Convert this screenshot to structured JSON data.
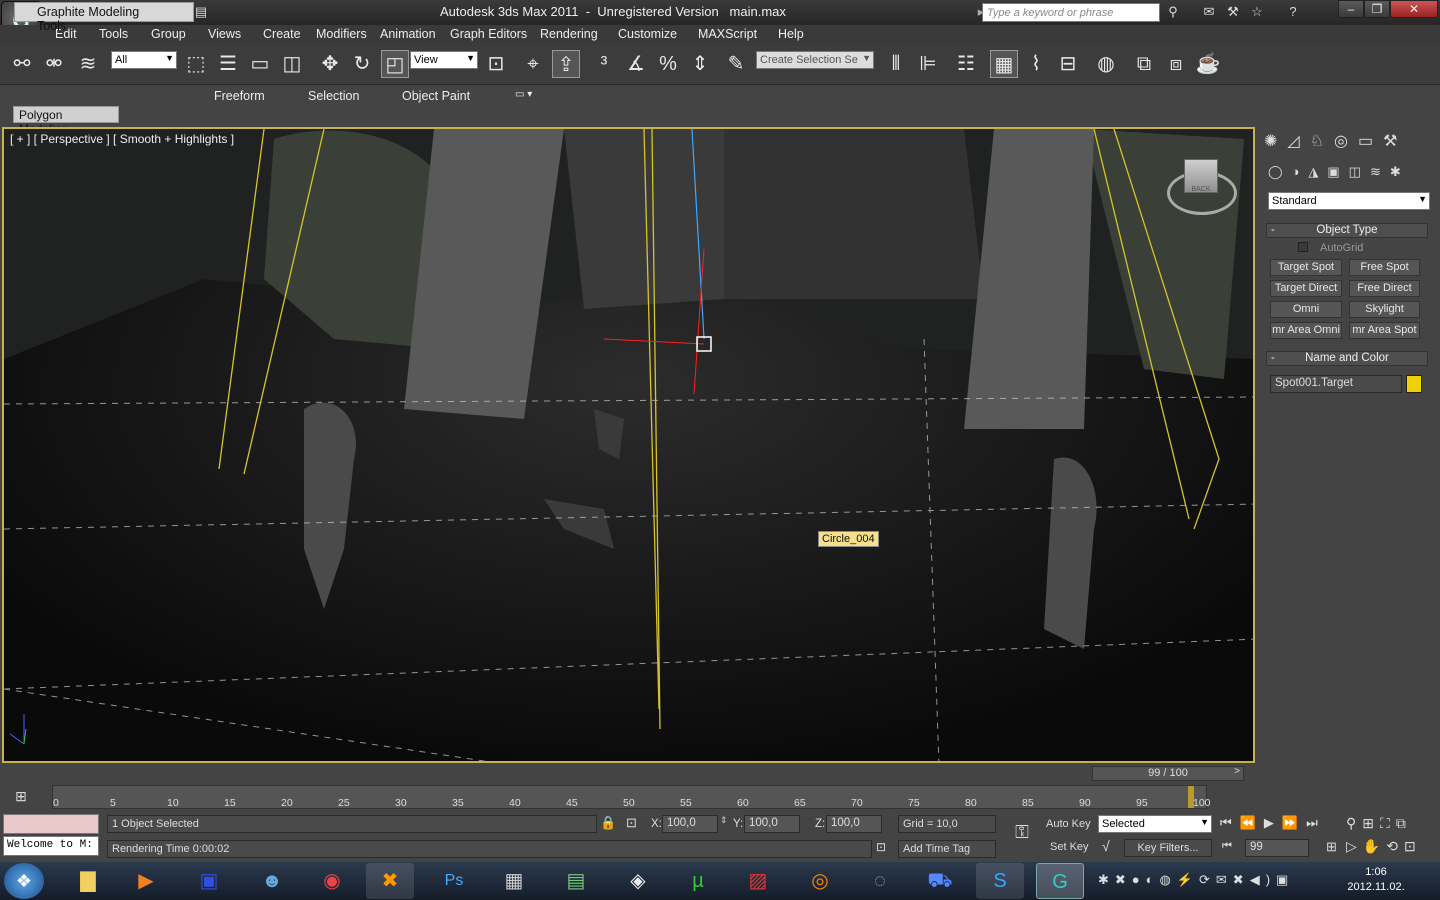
{
  "titlebar": {
    "app": "Autodesk 3ds Max  2011",
    "version": "Unregistered Version",
    "file": "main.max",
    "search_placeholder": "Type a keyword or phrase"
  },
  "menu": [
    "Edit",
    "Tools",
    "Group",
    "Views",
    "Create",
    "Modifiers",
    "Animation",
    "Graph Editors",
    "Rendering",
    "Customize",
    "MAXScript",
    "Help"
  ],
  "toolbar": {
    "selection_filter": "All",
    "reference_coord": "View",
    "named_selection_placeholder": "Create Selection Se"
  },
  "ribbon": {
    "tabs": [
      "Graphite Modeling Tools",
      "Freeform",
      "Selection",
      "Object Paint"
    ],
    "panel": "Polygon Modeling"
  },
  "viewport": {
    "label": "[ + ] [ Perspective ] [ Smooth + Highlights ]",
    "tooltip": "Circle_004",
    "viewcube": "BACK"
  },
  "command_panel": {
    "category": "Standard",
    "object_type_title": "Object Type",
    "autogrid": "AutoGrid",
    "buttons": [
      "Target Spot",
      "Free Spot",
      "Target Direct",
      "Free Direct",
      "Omni",
      "Skylight",
      "mr Area Omni",
      "mr Area Spot"
    ],
    "name_color_title": "Name and Color",
    "object_name": "Spot001.Target",
    "object_color": "#f0d000"
  },
  "timeline": {
    "slider": "99 / 100",
    "ticks": [
      "0",
      "5",
      "10",
      "15",
      "20",
      "25",
      "30",
      "35",
      "40",
      "45",
      "50",
      "55",
      "60",
      "65",
      "70",
      "75",
      "80",
      "85",
      "90",
      "95",
      "100"
    ]
  },
  "status": {
    "listener": "Welcome to M:",
    "selection": "1 Object Selected",
    "render_time": "Rendering Time  0:00:02",
    "x_label": "X:",
    "x": "100,0",
    "y_label": "Y:",
    "y": "100,0",
    "z_label": "Z:",
    "z": "100,0",
    "grid": "Grid = 10,0",
    "add_time_tag": "Add Time Tag",
    "auto_key": "Auto Key",
    "set_key": "Set Key",
    "key_mode": "Selected",
    "key_filters": "Key Filters...",
    "frame": "99"
  },
  "taskbar": {
    "time": "1:06",
    "date": "2012.11.02."
  }
}
